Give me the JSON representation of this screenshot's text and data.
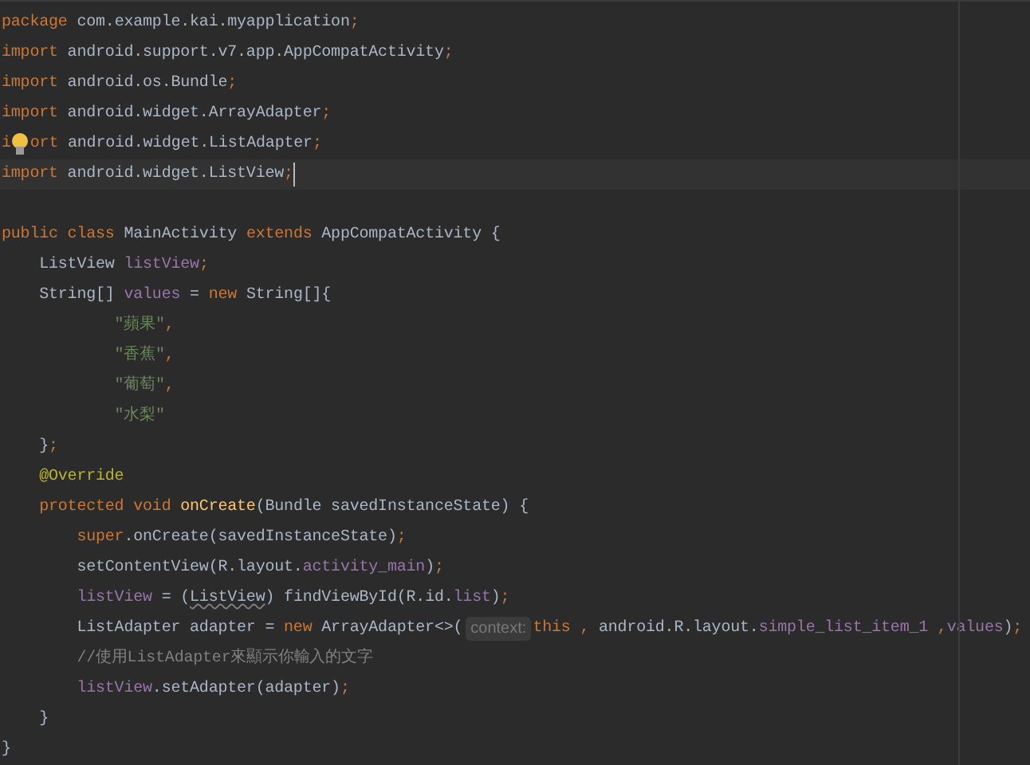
{
  "editor": {
    "lines": [
      {
        "current": false,
        "tokens": [
          {
            "kind": "keyword",
            "text": "package"
          },
          {
            "kind": "plain",
            "text": " com.example.kai.myapplication"
          },
          {
            "kind": "keyword",
            "text": ";"
          }
        ]
      },
      {
        "current": false,
        "tokens": [
          {
            "kind": "keyword",
            "text": "import"
          },
          {
            "kind": "plain",
            "text": " android.support.v7.app.AppCompatActivity"
          },
          {
            "kind": "keyword",
            "text": ";"
          }
        ]
      },
      {
        "current": false,
        "tokens": [
          {
            "kind": "keyword",
            "text": "import"
          },
          {
            "kind": "plain",
            "text": " android.os.Bundle"
          },
          {
            "kind": "keyword",
            "text": ";"
          }
        ]
      },
      {
        "current": false,
        "tokens": [
          {
            "kind": "keyword",
            "text": "import"
          },
          {
            "kind": "plain",
            "text": " android.widget.ArrayAdapter"
          },
          {
            "kind": "keyword",
            "text": ";"
          }
        ]
      },
      {
        "current": false,
        "tokens": [
          {
            "kind": "keyword",
            "text": "i"
          },
          {
            "kind": "bulb"
          },
          {
            "kind": "keyword",
            "text": "ort"
          },
          {
            "kind": "plain",
            "text": " android.widget.ListAdapter"
          },
          {
            "kind": "keyword",
            "text": ";"
          }
        ]
      },
      {
        "current": true,
        "tokens": [
          {
            "kind": "keyword",
            "text": "import"
          },
          {
            "kind": "plain",
            "text": " android.widget.ListView"
          },
          {
            "kind": "keyword",
            "text": ";"
          }
        ]
      },
      {
        "current": false
      },
      {
        "current": false,
        "tokens": [
          {
            "kind": "keyword",
            "text": "public class "
          },
          {
            "kind": "plain",
            "text": "MainActivity "
          },
          {
            "kind": "keyword",
            "text": "extends "
          },
          {
            "kind": "plain",
            "text": "AppCompatActivity {"
          }
        ]
      },
      {
        "current": false,
        "tokens": [
          {
            "kind": "plain",
            "text": "    ListView "
          },
          {
            "kind": "field",
            "text": "listView"
          },
          {
            "kind": "keyword",
            "text": ";"
          }
        ]
      },
      {
        "current": false,
        "tokens": [
          {
            "kind": "plain",
            "text": "    String[] "
          },
          {
            "kind": "field",
            "text": "values"
          },
          {
            "kind": "plain",
            "text": " = "
          },
          {
            "kind": "keyword",
            "text": "new "
          },
          {
            "kind": "plain",
            "text": "String[]{"
          }
        ]
      },
      {
        "current": false,
        "tokens": [
          {
            "kind": "string",
            "text": "            \"蘋果\""
          },
          {
            "kind": "keyword",
            "text": ","
          }
        ]
      },
      {
        "current": false,
        "tokens": [
          {
            "kind": "string",
            "text": "            \"香蕉\""
          },
          {
            "kind": "keyword",
            "text": ","
          }
        ]
      },
      {
        "current": false,
        "tokens": [
          {
            "kind": "string",
            "text": "            \"葡萄\""
          },
          {
            "kind": "keyword",
            "text": ","
          }
        ]
      },
      {
        "current": false,
        "tokens": [
          {
            "kind": "string",
            "text": "            \"水梨\""
          }
        ]
      },
      {
        "current": false,
        "tokens": [
          {
            "kind": "plain",
            "text": "    }"
          },
          {
            "kind": "keyword",
            "text": ";"
          }
        ]
      },
      {
        "current": false,
        "tokens": [
          {
            "kind": "annotation",
            "text": "    @Override"
          }
        ]
      },
      {
        "current": false,
        "tokens": [
          {
            "kind": "keyword",
            "text": "    protected void "
          },
          {
            "kind": "method",
            "text": "onCreate"
          },
          {
            "kind": "plain",
            "text": "(Bundle savedInstanceState) {"
          }
        ]
      },
      {
        "current": false,
        "tokens": [
          {
            "kind": "keyword",
            "text": "        super"
          },
          {
            "kind": "plain",
            "text": ".onCreate(savedInstanceState)"
          },
          {
            "kind": "keyword",
            "text": ";"
          }
        ]
      },
      {
        "current": false,
        "tokens": [
          {
            "kind": "plain",
            "text": "        setContentView(R.layout."
          },
          {
            "kind": "field",
            "text": "activity_main"
          },
          {
            "kind": "plain",
            "text": ")"
          },
          {
            "kind": "keyword",
            "text": ";"
          }
        ]
      },
      {
        "current": false,
        "tokens": [
          {
            "kind": "field",
            "text": "        listView"
          },
          {
            "kind": "plain",
            "text": " = ("
          },
          {
            "kind": "warning",
            "text": "ListView"
          },
          {
            "kind": "plain",
            "text": ") findViewById(R.id."
          },
          {
            "kind": "field",
            "text": "list"
          },
          {
            "kind": "plain",
            "text": ")"
          },
          {
            "kind": "keyword",
            "text": ";"
          }
        ]
      },
      {
        "current": false,
        "tokens": [
          {
            "kind": "plain",
            "text": "        ListAdapter adapter = "
          },
          {
            "kind": "keyword",
            "text": "new "
          },
          {
            "kind": "plain",
            "text": "ArrayAdapter<>("
          },
          {
            "kind": "hint",
            "text": "context:"
          },
          {
            "kind": "keyword",
            "text": "this ,"
          },
          {
            "kind": "plain",
            "text": " android.R.layout."
          },
          {
            "kind": "field",
            "text": "simple_list_item_1"
          },
          {
            "kind": "keyword",
            "text": " ,"
          },
          {
            "kind": "field",
            "text": "values"
          },
          {
            "kind": "plain",
            "text": ")"
          },
          {
            "kind": "keyword",
            "text": ";"
          }
        ]
      },
      {
        "current": false,
        "tokens": [
          {
            "kind": "comment",
            "text": "        //使用ListAdapter來顯示你輸入的文字"
          }
        ]
      },
      {
        "current": false,
        "tokens": [
          {
            "kind": "field",
            "text": "        listView"
          },
          {
            "kind": "plain",
            "text": ".setAdapter(adapter)"
          },
          {
            "kind": "keyword",
            "text": ";"
          }
        ]
      },
      {
        "current": false,
        "tokens": [
          {
            "kind": "plain",
            "text": "    }"
          }
        ]
      },
      {
        "current": false,
        "tokens": [
          {
            "kind": "plain",
            "text": "}"
          }
        ]
      }
    ]
  }
}
